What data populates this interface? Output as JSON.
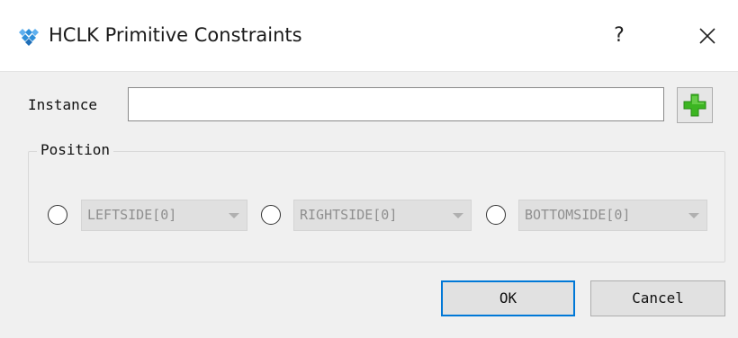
{
  "window": {
    "title": "HCLK Primitive Constraints",
    "help_label": "?",
    "icon": "gowin-logo-icon"
  },
  "instance": {
    "label": "Instance",
    "value": "",
    "add_icon": "plus-icon"
  },
  "position_group": {
    "legend": "Position",
    "options": [
      {
        "value": "LEFTSIDE[0]",
        "selected": false,
        "enabled": false
      },
      {
        "value": "RIGHTSIDE[0]",
        "selected": false,
        "enabled": false
      },
      {
        "value": "BOTTOMSIDE[0]",
        "selected": false,
        "enabled": false
      }
    ]
  },
  "buttons": {
    "ok_label": "OK",
    "cancel_label": "Cancel"
  },
  "colors": {
    "accent": "#0078d7",
    "plus_icon": "#3cb521",
    "logo": "#2f8fd9"
  }
}
